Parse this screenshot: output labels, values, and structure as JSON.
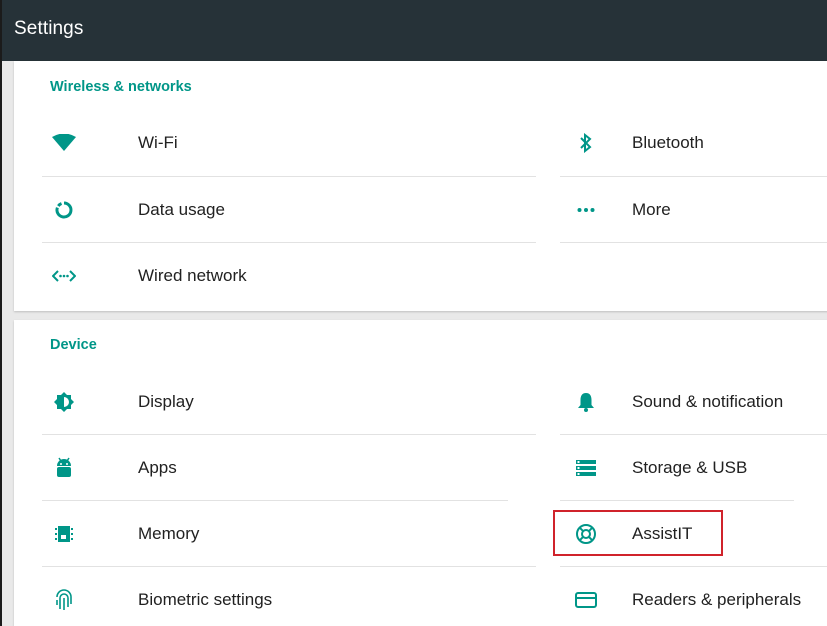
{
  "app": {
    "title": "Settings"
  },
  "sections": {
    "wireless": {
      "title": "Wireless & networks",
      "items": {
        "wifi": {
          "label": "Wi-Fi",
          "icon": "wifi-icon"
        },
        "bluetooth": {
          "label": "Bluetooth",
          "icon": "bluetooth-icon"
        },
        "data_usage": {
          "label": "Data usage",
          "icon": "data-usage-icon"
        },
        "more": {
          "label": "More",
          "icon": "more-icon"
        },
        "wired": {
          "label": "Wired network",
          "icon": "wired-network-icon"
        }
      }
    },
    "device": {
      "title": "Device",
      "items": {
        "display": {
          "label": "Display",
          "icon": "brightness-icon"
        },
        "sound": {
          "label": "Sound & notification",
          "icon": "bell-icon"
        },
        "apps": {
          "label": "Apps",
          "icon": "android-icon"
        },
        "storage": {
          "label": "Storage & USB",
          "icon": "storage-icon"
        },
        "memory": {
          "label": "Memory",
          "icon": "memory-chip-icon"
        },
        "assistit": {
          "label": "AssistIT",
          "icon": "lifebuoy-icon"
        },
        "biometric": {
          "label": "Biometric settings",
          "icon": "fingerprint-icon"
        },
        "readers": {
          "label": "Readers & peripherals",
          "icon": "card-reader-icon"
        }
      }
    }
  },
  "colors": {
    "appbar": "#263238",
    "accent": "#009688",
    "highlight": "#d0232b",
    "background": "#e9e9e9"
  }
}
